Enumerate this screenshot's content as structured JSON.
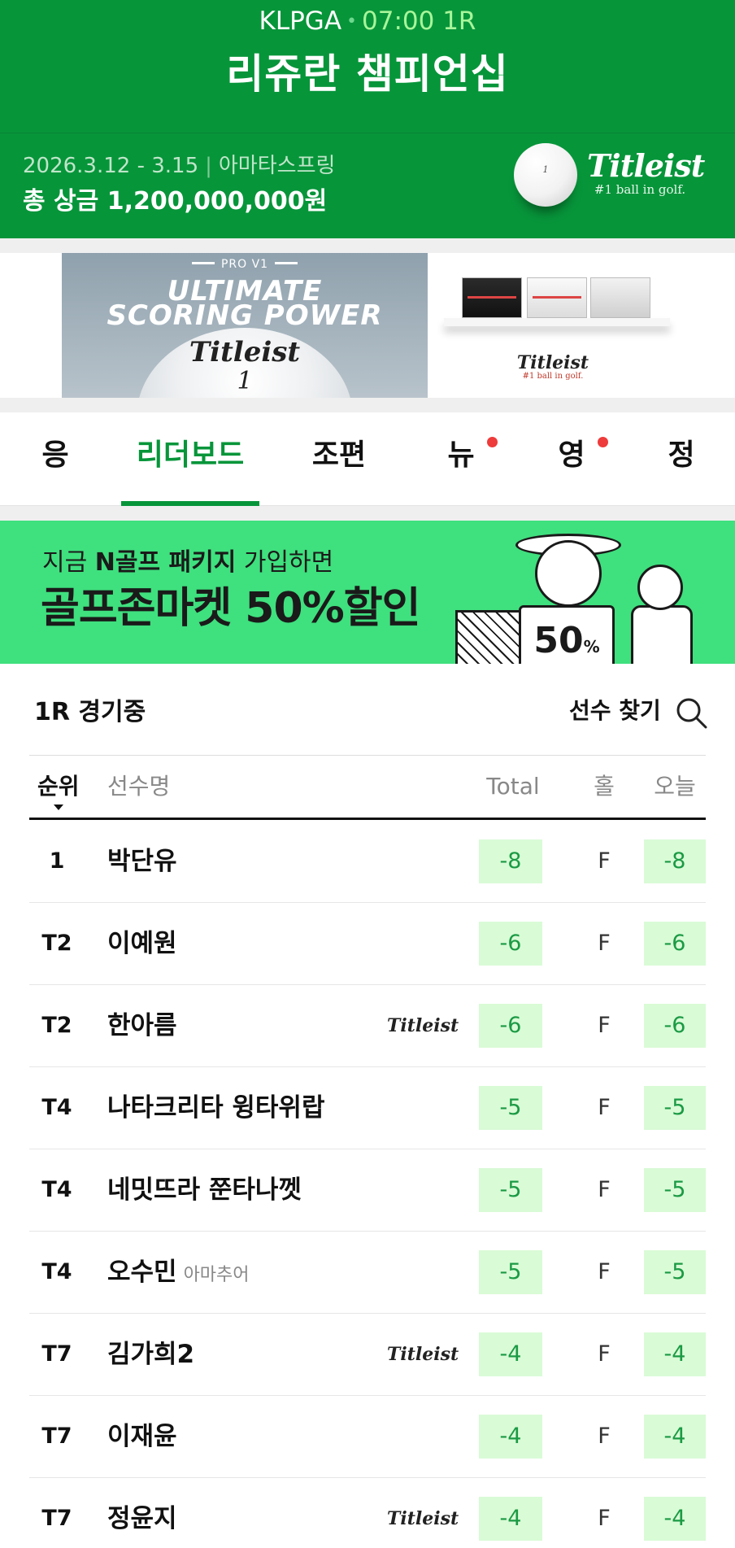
{
  "header": {
    "tour": "KLPGA",
    "separator": "•",
    "time_round": "07:00 1R",
    "title": "리쥬란 챔피언십",
    "dates": "2026.3.12 - 3.15",
    "divider": "|",
    "venue": "아마타스프링",
    "prize": "총 상금 1,200,000,000원",
    "ball_mark": "1",
    "sponsor_name": "Titleist",
    "sponsor_tagline": "#1 ball in golf."
  },
  "ad": {
    "product": "PRO V1",
    "headline_1": "ULTIMATE",
    "headline_2": "SCORING POWER",
    "ball_logo": "Titleist",
    "ball_number": "1",
    "brand": "Titleist",
    "tagline": "#1 ball in golf."
  },
  "tabs": [
    {
      "label": "응원",
      "active": false,
      "badge": false
    },
    {
      "label": "리더보드",
      "active": true,
      "badge": false
    },
    {
      "label": "조편성",
      "active": false,
      "badge": false
    },
    {
      "label": "뉴스",
      "active": false,
      "badge": true
    },
    {
      "label": "영상",
      "active": false,
      "badge": true
    },
    {
      "label": "정보",
      "active": false,
      "badge": false
    }
  ],
  "promo": {
    "line1_prefix": "지금 ",
    "line1_bold": "N골프 패키지",
    "line1_suffix": " 가입하면",
    "line2": "골프존마켓 50%할인",
    "sign_value": "50",
    "sign_unit": "%"
  },
  "leaderboard": {
    "status": "1R 경기중",
    "find_player": "선수 찾기",
    "columns": {
      "rank": "순위",
      "name": "선수명",
      "total": "Total",
      "hole": "홀",
      "today": "오늘"
    },
    "amateur_label": "아마추어",
    "sponsor_mark": "Titleist",
    "rows": [
      {
        "rank": "1",
        "name": "박단유",
        "total": "-8",
        "hole": "F",
        "today": "-8"
      },
      {
        "rank": "T2",
        "name": "이예원",
        "total": "-6",
        "hole": "F",
        "today": "-6"
      },
      {
        "rank": "T2",
        "name": "한아름",
        "sponsor": "Titleist",
        "total": "-6",
        "hole": "F",
        "today": "-6"
      },
      {
        "rank": "T4",
        "name": "나타크리타 윙타위랍",
        "total": "-5",
        "hole": "F",
        "today": "-5"
      },
      {
        "rank": "T4",
        "name": "네밋뜨라 쭌타나껫",
        "total": "-5",
        "hole": "F",
        "today": "-5"
      },
      {
        "rank": "T4",
        "name": "오수민",
        "amateur": "아마추어",
        "total": "-5",
        "hole": "F",
        "today": "-5"
      },
      {
        "rank": "T7",
        "name": "김가희2",
        "sponsor": "Titleist",
        "total": "-4",
        "hole": "F",
        "today": "-4"
      },
      {
        "rank": "T7",
        "name": "이재윤",
        "total": "-4",
        "hole": "F",
        "today": "-4"
      },
      {
        "rank": "T7",
        "name": "정윤지",
        "sponsor": "Titleist",
        "total": "-4",
        "hole": "F",
        "today": "-4"
      }
    ]
  },
  "colors": {
    "brand_green": "#07953a",
    "promo_green": "#3fe07e",
    "score_bg": "#d9fbd6",
    "score_text": "#1b9a44",
    "badge_red": "#ee3b3b"
  }
}
